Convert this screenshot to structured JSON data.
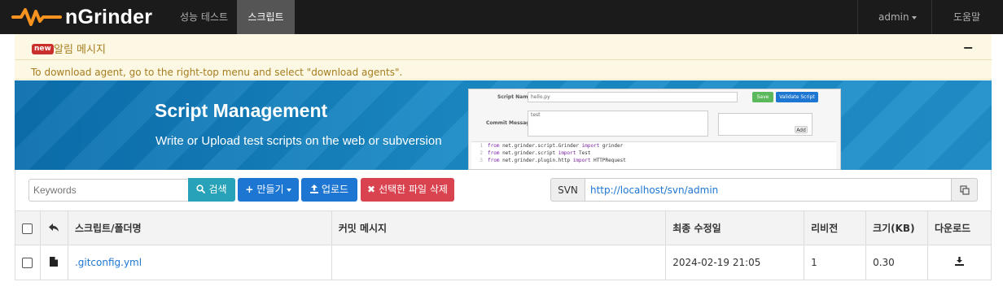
{
  "app": {
    "name": "nGrinder"
  },
  "nav": {
    "items": [
      {
        "label": "성능 테스트",
        "active": false
      },
      {
        "label": "스크립트",
        "active": true
      }
    ],
    "user": "admin",
    "help": "도움말"
  },
  "notice": {
    "badge": "new",
    "title": "알림 메시지",
    "toggle": "−",
    "text": "To download agent, go to the right-top menu and select \"download agents\"."
  },
  "banner": {
    "title": "Script Management",
    "subtitle": "Write or Upload test scripts on the web or subversion",
    "preview": {
      "script_name_label": "Script Name",
      "script_name_value": "hello.py",
      "save_label": "Save",
      "validate_label": "Validate Script",
      "commit_label": "Commit Message",
      "commit_value": "test",
      "add_label": "Add",
      "code_lines": [
        {
          "n": "1",
          "a": "from",
          "b": " net.grinder.script.Grinder ",
          "c": "import",
          "d": " grinder"
        },
        {
          "n": "2",
          "a": "from",
          "b": " net.grinder.script ",
          "c": "import",
          "d": " Test"
        },
        {
          "n": "3",
          "a": "from",
          "b": " net.grinder.plugin.http ",
          "c": "import",
          "d": " HTTPRequest"
        }
      ]
    }
  },
  "toolbar": {
    "search_placeholder": "Keywords",
    "search_label": "검색",
    "create_label": "만들기",
    "upload_label": "업로드",
    "delete_label": "선택한 파일 삭제",
    "svn_label": "SVN",
    "svn_url": "http://localhost/svn/admin"
  },
  "table": {
    "headers": {
      "name": "스크립트/폴더명",
      "commit": "커밋 메시지",
      "modified": "최종 수정일",
      "revision": "리비전",
      "size": "크기(KB)",
      "download": "다운로드"
    },
    "rows": [
      {
        "name": ".gitconfig.yml",
        "commit": "",
        "modified": "2024-02-19 21:05",
        "revision": "1",
        "size": "0.30"
      }
    ]
  },
  "colors": {
    "navbar": "#1b1b1b",
    "logo_orange": "#f7931e",
    "notice_bg": "#fcf8e3",
    "primary": "#1d76d2",
    "info": "#27a2b8",
    "danger": "#d9434f"
  }
}
